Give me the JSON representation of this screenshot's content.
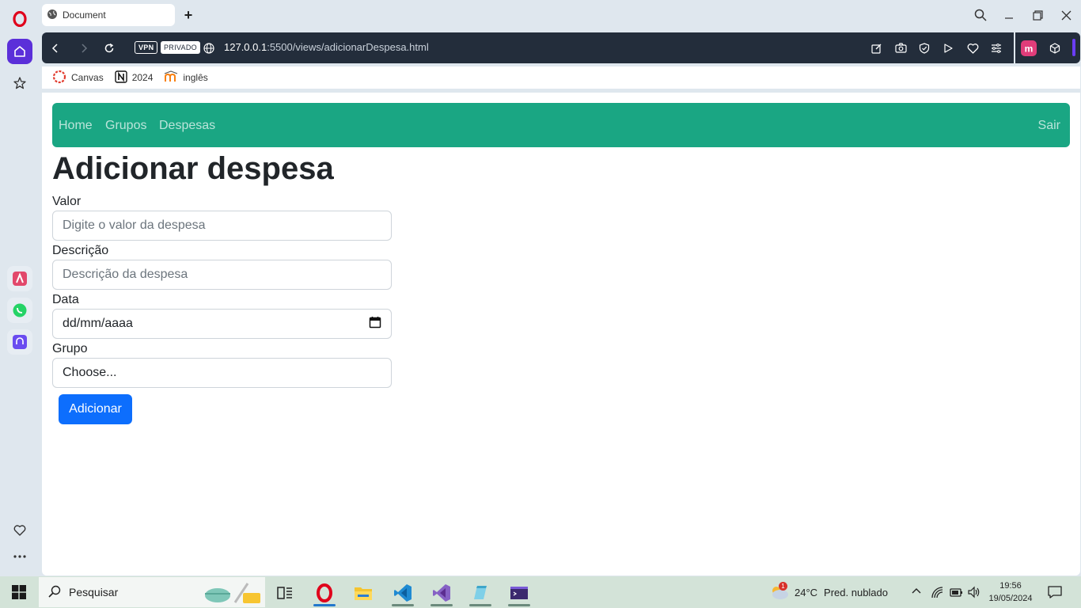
{
  "browser": {
    "tab_title": "Document",
    "new_tab": "+",
    "vpn": "VPN",
    "private": "PRIVADO",
    "url_host": "127.0.0.1",
    "url_rest": ":5500/views/adicionarDespesa.html",
    "bookmarks": [
      {
        "label": "Canvas"
      },
      {
        "label": "2024"
      },
      {
        "label": "inglês"
      }
    ]
  },
  "navbar": {
    "home": "Home",
    "groups": "Grupos",
    "expenses": "Despesas",
    "logout": "Sair"
  },
  "page": {
    "title": "Adicionar despesa"
  },
  "form": {
    "value_label": "Valor",
    "value_placeholder": "Digite o valor da despesa",
    "desc_label": "Descrição",
    "desc_placeholder": "Descrição da despesa",
    "date_label": "Data",
    "date_value": "dd/mm/aaaa",
    "group_label": "Grupo",
    "group_selected": "Choose...",
    "submit": "Adicionar"
  },
  "taskbar": {
    "search": "Pesquisar",
    "weather_temp": "24°C",
    "weather_desc": "Pred. nublado",
    "weather_badge": "1",
    "time": "19:56",
    "date": "19/05/2024"
  },
  "colors": {
    "navbar": "#1aa683",
    "primary": "#0d6efd",
    "opera_red": "#e0001b",
    "address_bar": "#232d3b"
  }
}
